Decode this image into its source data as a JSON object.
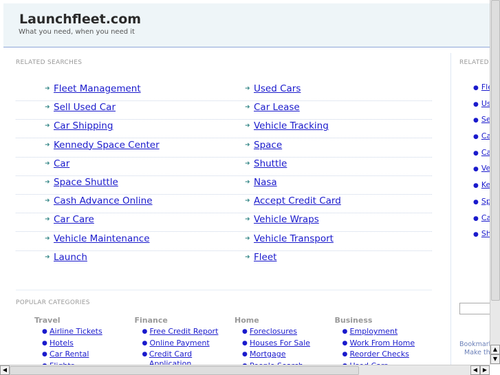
{
  "header": {
    "title": "Launchfleet.com",
    "tagline": "What you need, when you need it"
  },
  "related": {
    "label": "RELATED SEARCHES",
    "left": [
      "Fleet Management",
      "Sell Used Car",
      "Car Shipping",
      "Kennedy Space Center",
      "Car",
      "Space Shuttle",
      "Cash Advance Online",
      "Car Care",
      "Vehicle Maintenance",
      "Launch"
    ],
    "right": [
      "Used Cars",
      "Car Lease",
      "Vehicle Tracking",
      "Space",
      "Shuttle",
      "Nasa",
      "Accept Credit Card",
      "Vehicle Wraps",
      "Vehicle Transport",
      "Fleet"
    ]
  },
  "popular": {
    "label": "POPULAR CATEGORIES",
    "columns": [
      {
        "title": "Travel",
        "items": [
          "Airline Tickets",
          "Hotels",
          "Car Rental",
          "Flights"
        ]
      },
      {
        "title": "Finance",
        "items": [
          "Free Credit Report",
          "Online Payment",
          "Credit Card Application"
        ]
      },
      {
        "title": "Home",
        "items": [
          "Foreclosures",
          "Houses For Sale",
          "Mortgage",
          "People Search"
        ]
      },
      {
        "title": "Business",
        "items": [
          "Employment",
          "Work From Home",
          "Reorder Checks",
          "Used Cars"
        ]
      }
    ]
  },
  "sidebar": {
    "label": "RELATED",
    "items": [
      "Fleet Management",
      "Used Cars",
      "Sell Used Car",
      "Car Lease",
      "Car Shipping",
      "Vehicle Tracking",
      "Kennedy Space Center",
      "Space",
      "Car",
      "Shuttle"
    ],
    "bookmark": "Bookmark this page",
    "make_this": "Make this your homepage"
  }
}
